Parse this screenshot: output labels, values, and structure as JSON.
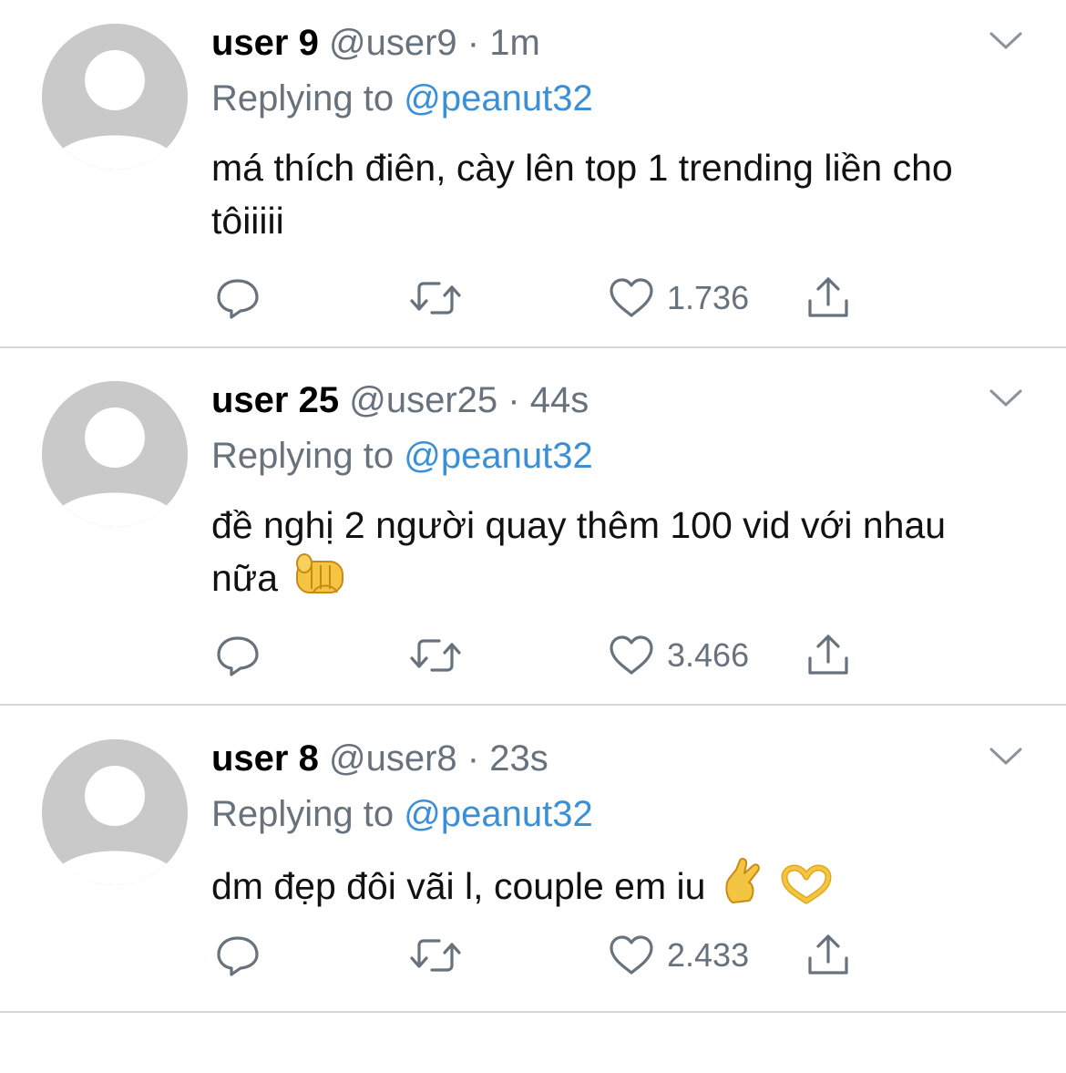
{
  "tweets": [
    {
      "display_name": "user 9",
      "handle": "@user9",
      "separator": "·",
      "time": "1m",
      "replying_prefix": "Replying to",
      "replying_to": "@peanut32",
      "text": "má thích điên, cày lên top 1 trending liền cho tôiiiii",
      "emojis": [],
      "likes": "1.736"
    },
    {
      "display_name": "user 25",
      "handle": "@user25",
      "separator": "·",
      "time": "44s",
      "replying_prefix": "Replying to",
      "replying_to": "@peanut32",
      "text": "đề nghị 2 người quay thêm 100 vid với nhau nữa",
      "emojis": [
        "punch-emoji"
      ],
      "likes": "3.466"
    },
    {
      "display_name": "user 8",
      "handle": "@user8",
      "separator": "·",
      "time": "23s",
      "replying_prefix": "Replying to",
      "replying_to": "@peanut32",
      "text": "dm đẹp đôi vãi l, couple em iu",
      "emojis": [
        "crossed-fingers-emoji",
        "heart-hands-emoji"
      ],
      "likes": "2.433"
    }
  ],
  "icons": {
    "avatar": "default-avatar-icon",
    "menu": "chevron-down-icon",
    "reply": "reply-icon",
    "retweet": "retweet-icon",
    "like": "heart-icon",
    "share": "share-icon"
  },
  "colors": {
    "handle_gray": "#67727c",
    "mention_blue": "#3b8fd6",
    "avatar_gray": "#c9c9c9",
    "divider": "#d3d6da",
    "emoji_yellow": "#f4c542"
  }
}
